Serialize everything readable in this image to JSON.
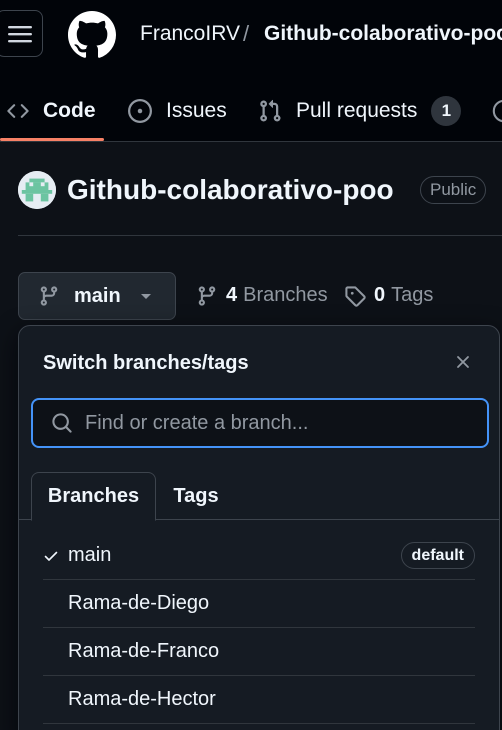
{
  "header": {
    "owner": "FrancoIRV",
    "separator": "/",
    "repo": "Github-colaborativo-poo"
  },
  "nav_tabs": [
    {
      "label": "Code",
      "icon": "code-icon",
      "selected": true
    },
    {
      "label": "Issues",
      "icon": "issue-opened-icon"
    },
    {
      "label": "Pull requests",
      "icon": "git-pull-request-icon",
      "count": "1"
    }
  ],
  "repo": {
    "title": "Github-colaborativo-poo",
    "visibility": "Public"
  },
  "branch_bar": {
    "current_branch": "main",
    "branches_count": "4",
    "branches_label": "Branches",
    "tags_count": "0",
    "tags_label": "Tags"
  },
  "dropdown": {
    "title": "Switch branches/tags",
    "search_placeholder": "Find or create a branch...",
    "tabs": [
      "Branches",
      "Tags"
    ],
    "active_tab": "Branches",
    "branches": [
      {
        "name": "main",
        "checked": true,
        "badge": "default"
      },
      {
        "name": "Rama-de-Diego"
      },
      {
        "name": "Rama-de-Franco"
      },
      {
        "name": "Rama-de-Hector"
      }
    ]
  },
  "colors": {
    "background": "#0d1117",
    "header_bg": "#010409",
    "accent_underline": "#f78166",
    "focus_border": "#4493f8",
    "muted_text": "#9198a1"
  }
}
